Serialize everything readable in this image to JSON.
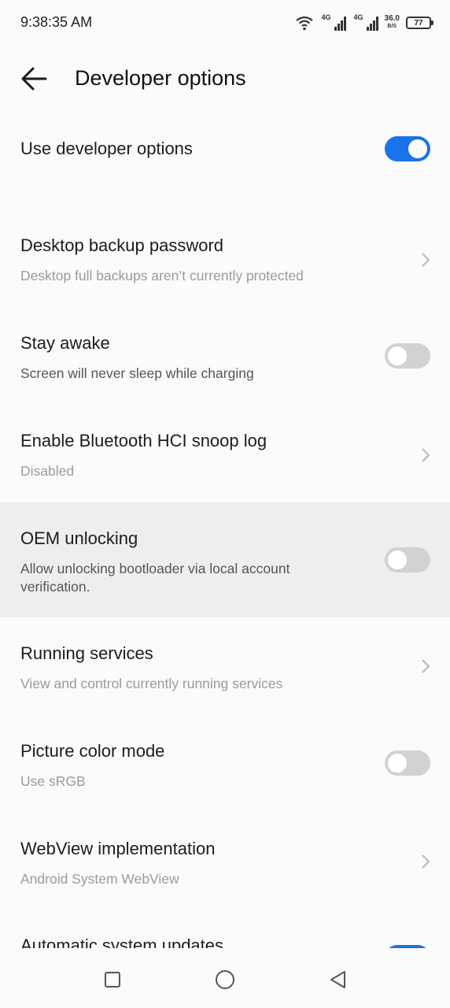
{
  "status": {
    "time": "9:38:35 AM",
    "net1": "4G",
    "net2": "4G",
    "speed_value": "36.0",
    "speed_unit": "B/S",
    "battery": "77"
  },
  "header": {
    "title": "Developer options"
  },
  "items": [
    {
      "title": "Use developer options",
      "toggle": "on"
    },
    {
      "title": "Desktop backup password",
      "subtitle": "Desktop full backups aren’t currently protected",
      "control": "chevron"
    },
    {
      "title": "Stay awake",
      "subtitle": "Screen will never sleep while charging",
      "toggle": "off"
    },
    {
      "title": "Enable Bluetooth HCI snoop log",
      "subtitle": "Disabled",
      "control": "chevron"
    },
    {
      "title": "OEM unlocking",
      "subtitle": "Allow unlocking bootloader via local account verification.",
      "toggle": "off"
    },
    {
      "title": "Running services",
      "subtitle": "View and control currently running services",
      "control": "chevron"
    },
    {
      "title": "Picture color mode",
      "subtitle": "Use sRGB",
      "toggle": "off"
    },
    {
      "title": "WebView implementation",
      "subtitle": "Android System WebView",
      "control": "chevron"
    },
    {
      "title": "Automatic system updates",
      "toggle": "on"
    }
  ],
  "colors": {
    "accent": "#1a73e8",
    "toggle_off": "#d2d2d2",
    "highlight_row": "#eeeeee"
  },
  "nav": {
    "recents": "square-icon",
    "home": "circle-icon",
    "back": "triangle-back-icon"
  }
}
